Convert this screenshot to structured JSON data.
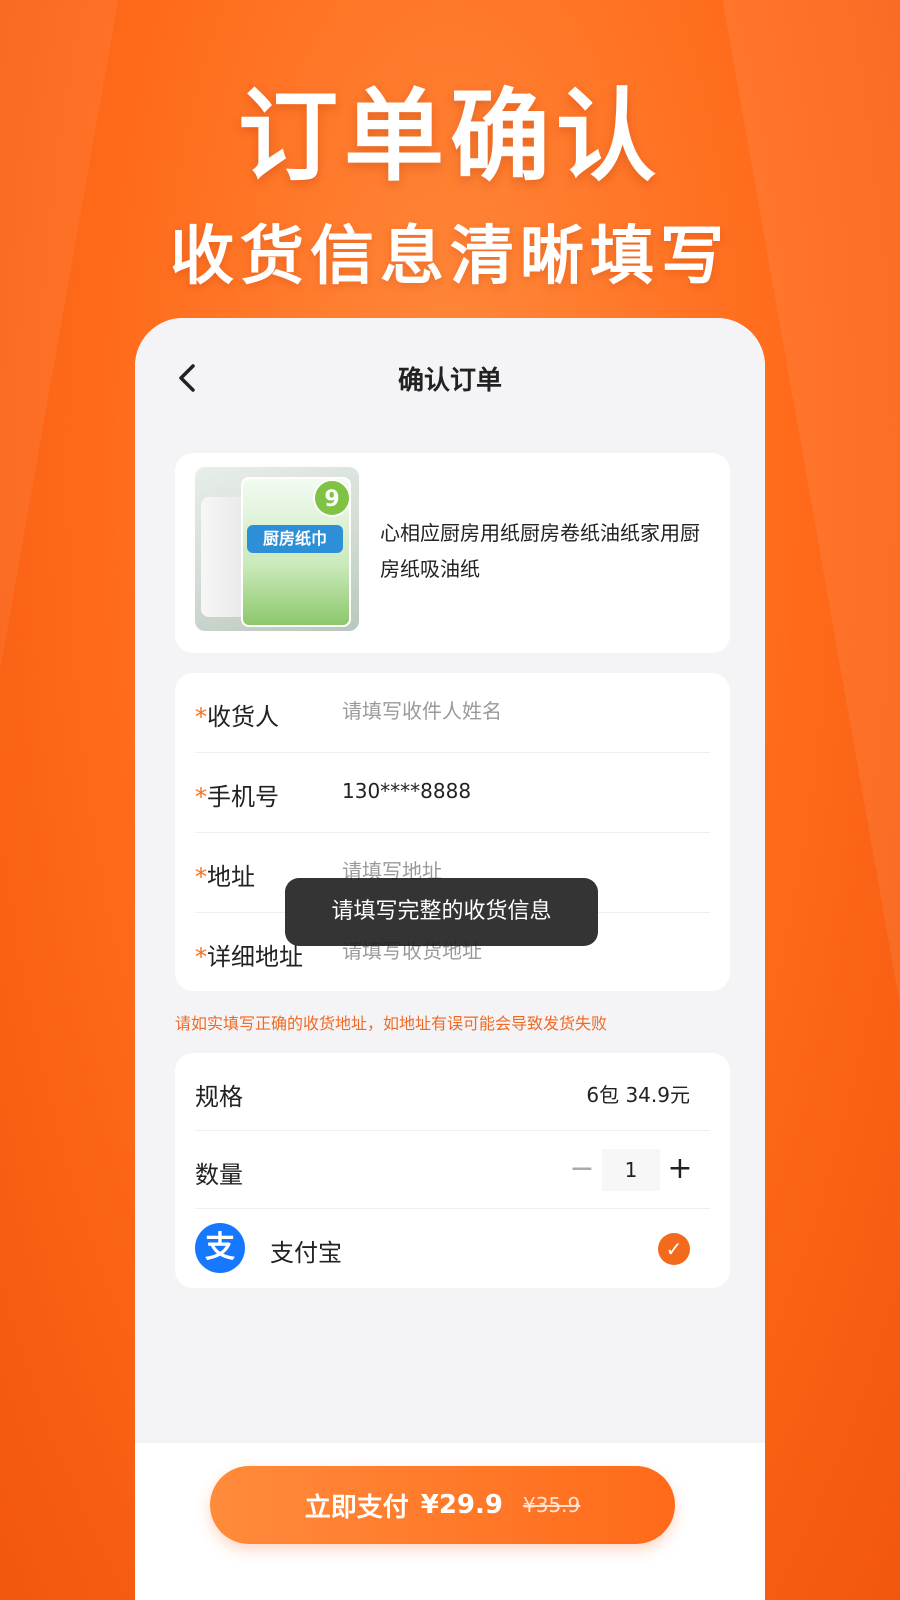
{
  "hero": {
    "title": "订单确认",
    "subtitle": "收货信息清晰填写"
  },
  "nav": {
    "back_icon": "chevron-left-icon",
    "title": "确认订单"
  },
  "product": {
    "name": "心相应厨房用纸厨房卷纸油纸家用厨房纸吸油纸",
    "image_label": "厨房纸巾",
    "image_badge": "9"
  },
  "form": {
    "receiver": {
      "required_mark": "*",
      "label": "收货人",
      "placeholder": "请填写收件人姓名",
      "value": ""
    },
    "phone": {
      "required_mark": "*",
      "label": "手机号",
      "placeholder": "",
      "value": "130****8888"
    },
    "address": {
      "required_mark": "*",
      "label": "地址",
      "placeholder": "请填写地址",
      "value": ""
    },
    "detail": {
      "required_mark": "*",
      "label": "详细地址",
      "placeholder": "请填写收货地址",
      "value": ""
    }
  },
  "warning": "请如实填写正确的收货地址，如地址有误可能会导致发货失败",
  "spec": {
    "label": "规格",
    "value": "6包 34.9元"
  },
  "quantity": {
    "label": "数量",
    "minus": "−",
    "value": "1",
    "plus": "+"
  },
  "payment": {
    "logo_glyph": "支",
    "label": "支付宝",
    "check_glyph": "✓",
    "selected": true
  },
  "pay_button": {
    "label": "立即支付",
    "price": "¥29.9",
    "original_price": "¥35.9"
  },
  "toast": "请填写完整的收货信息",
  "colors": {
    "accent": "#ff6a1a",
    "alipay": "#1677ff",
    "toast_bg": "#1e1e1e"
  }
}
